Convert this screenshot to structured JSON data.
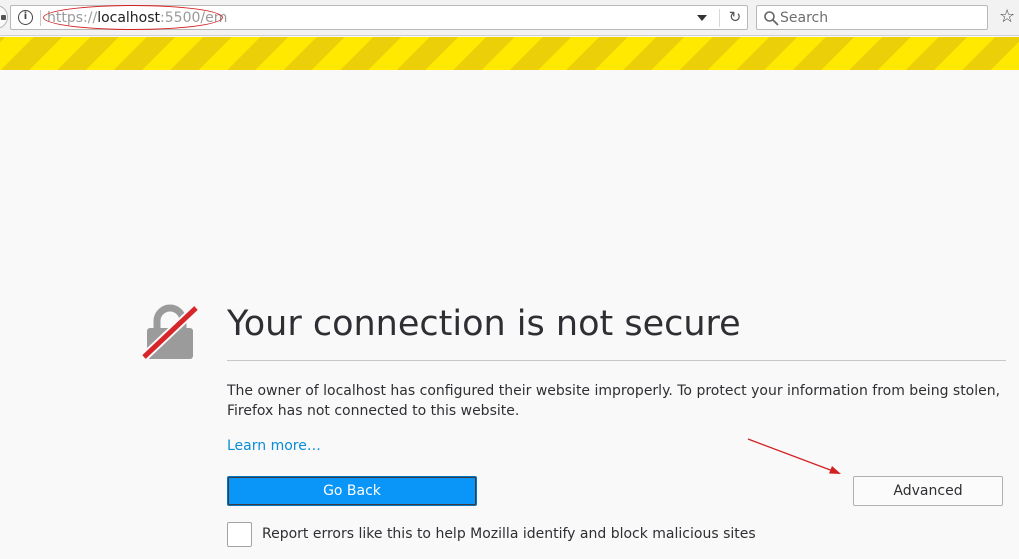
{
  "toolbar": {
    "url": {
      "scheme": "https://",
      "host": "localhost",
      "rest": ":5500/em"
    },
    "search_placeholder": "Search"
  },
  "page": {
    "title": "Your connection is not secure",
    "description": "The owner of localhost has configured their website improperly. To protect your information from being stolen, Firefox has not connected to this website.",
    "learn_more": "Learn more…",
    "go_back": "Go Back",
    "advanced": "Advanced",
    "report_label": "Report errors like this to help Mozilla identify and block malicious sites",
    "report_checked": false
  },
  "icons": {
    "info": "info-icon",
    "dropdown": "chevron-down-icon",
    "reload": "reload-icon",
    "search": "search-icon",
    "bookmark": "star-icon",
    "lock": "broken-lock-icon"
  },
  "colors": {
    "stripe_yellow": "#ffe900",
    "stripe_dark": "#ebcf08",
    "primary_button": "#0996f8",
    "link": "#0a8cd8",
    "annotation_red": "#d32020",
    "lock_gray": "#9b9b9b",
    "lock_slash": "#d7262a"
  }
}
